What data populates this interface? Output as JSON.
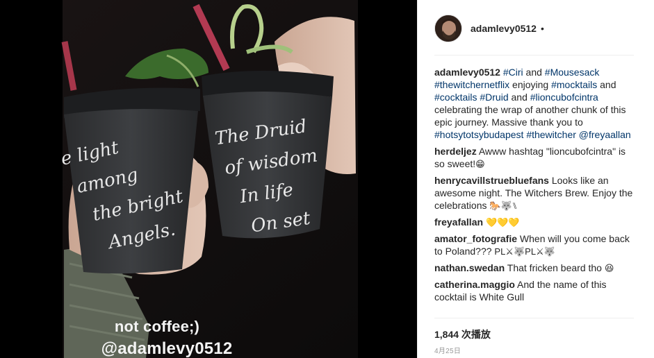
{
  "media": {
    "overlay_line1": "not coffee;)",
    "overlay_line2": "@adamlevy0512",
    "cup_left_lines": [
      "e light",
      "among",
      "the bright",
      "Angels."
    ],
    "cup_right_lines": [
      "The Druid",
      "of wisdom",
      "In life",
      "On set"
    ]
  },
  "post": {
    "username": "adamlevy0512",
    "dot": "•"
  },
  "caption": {
    "user": "adamlevy0512",
    "segments": [
      {
        "t": "#Ciri",
        "tag": true
      },
      {
        "t": " and ",
        "tag": false
      },
      {
        "t": "#Mousesack",
        "tag": true
      },
      {
        "t": " ",
        "tag": false
      },
      {
        "t": "#thewitchernetflix",
        "tag": true
      },
      {
        "t": " enjoying ",
        "tag": false
      },
      {
        "t": "#mocktails",
        "tag": true
      },
      {
        "t": " and ",
        "tag": false
      },
      {
        "t": "#cocktails",
        "tag": true
      },
      {
        "t": " ",
        "tag": false
      },
      {
        "t": "#Druid",
        "tag": true
      },
      {
        "t": " and ",
        "tag": false
      },
      {
        "t": "#lioncubofcintra",
        "tag": true
      },
      {
        "t": " celebrating the wrap of another chunk of this epic journey. Massive thank you to ",
        "tag": false
      },
      {
        "t": "#hotsytotsybudapest",
        "tag": true
      },
      {
        "t": " ",
        "tag": false
      },
      {
        "t": "#thewitcher",
        "tag": true
      },
      {
        "t": " ",
        "tag": false
      },
      {
        "t": "@freyaallan",
        "tag": true
      }
    ]
  },
  "comments": [
    {
      "user": "herdeljez",
      "text": "Awww hashtag \"lioncubofcintra\" is so sweet!",
      "emoji": "😁"
    },
    {
      "user": "henrycavillstruebluefans",
      "text": "Looks like an awesome night. The Witchers Brew. Enjoy the celebrations",
      "emoji": "🐎🐺⑊"
    },
    {
      "user": "freyafallan",
      "text": "",
      "emoji": "💛💛💛"
    },
    {
      "user": "amator_fotografie",
      "text": "When will you come back to Poland??? ",
      "emoji": "PL⚔🐺PL⚔🐺"
    },
    {
      "user": "nathan.swedan",
      "text": "That fricken beard tho",
      "emoji": "😆"
    },
    {
      "user": "catherina.maggio",
      "text": "And the name of this cocktail is White Gull",
      "emoji": ""
    }
  ],
  "stats": {
    "views": "1,844 次播放",
    "date": "4月25日"
  },
  "colors": {
    "link": "#003569",
    "text": "#262626",
    "muted": "#999999",
    "divider": "#efefef"
  }
}
